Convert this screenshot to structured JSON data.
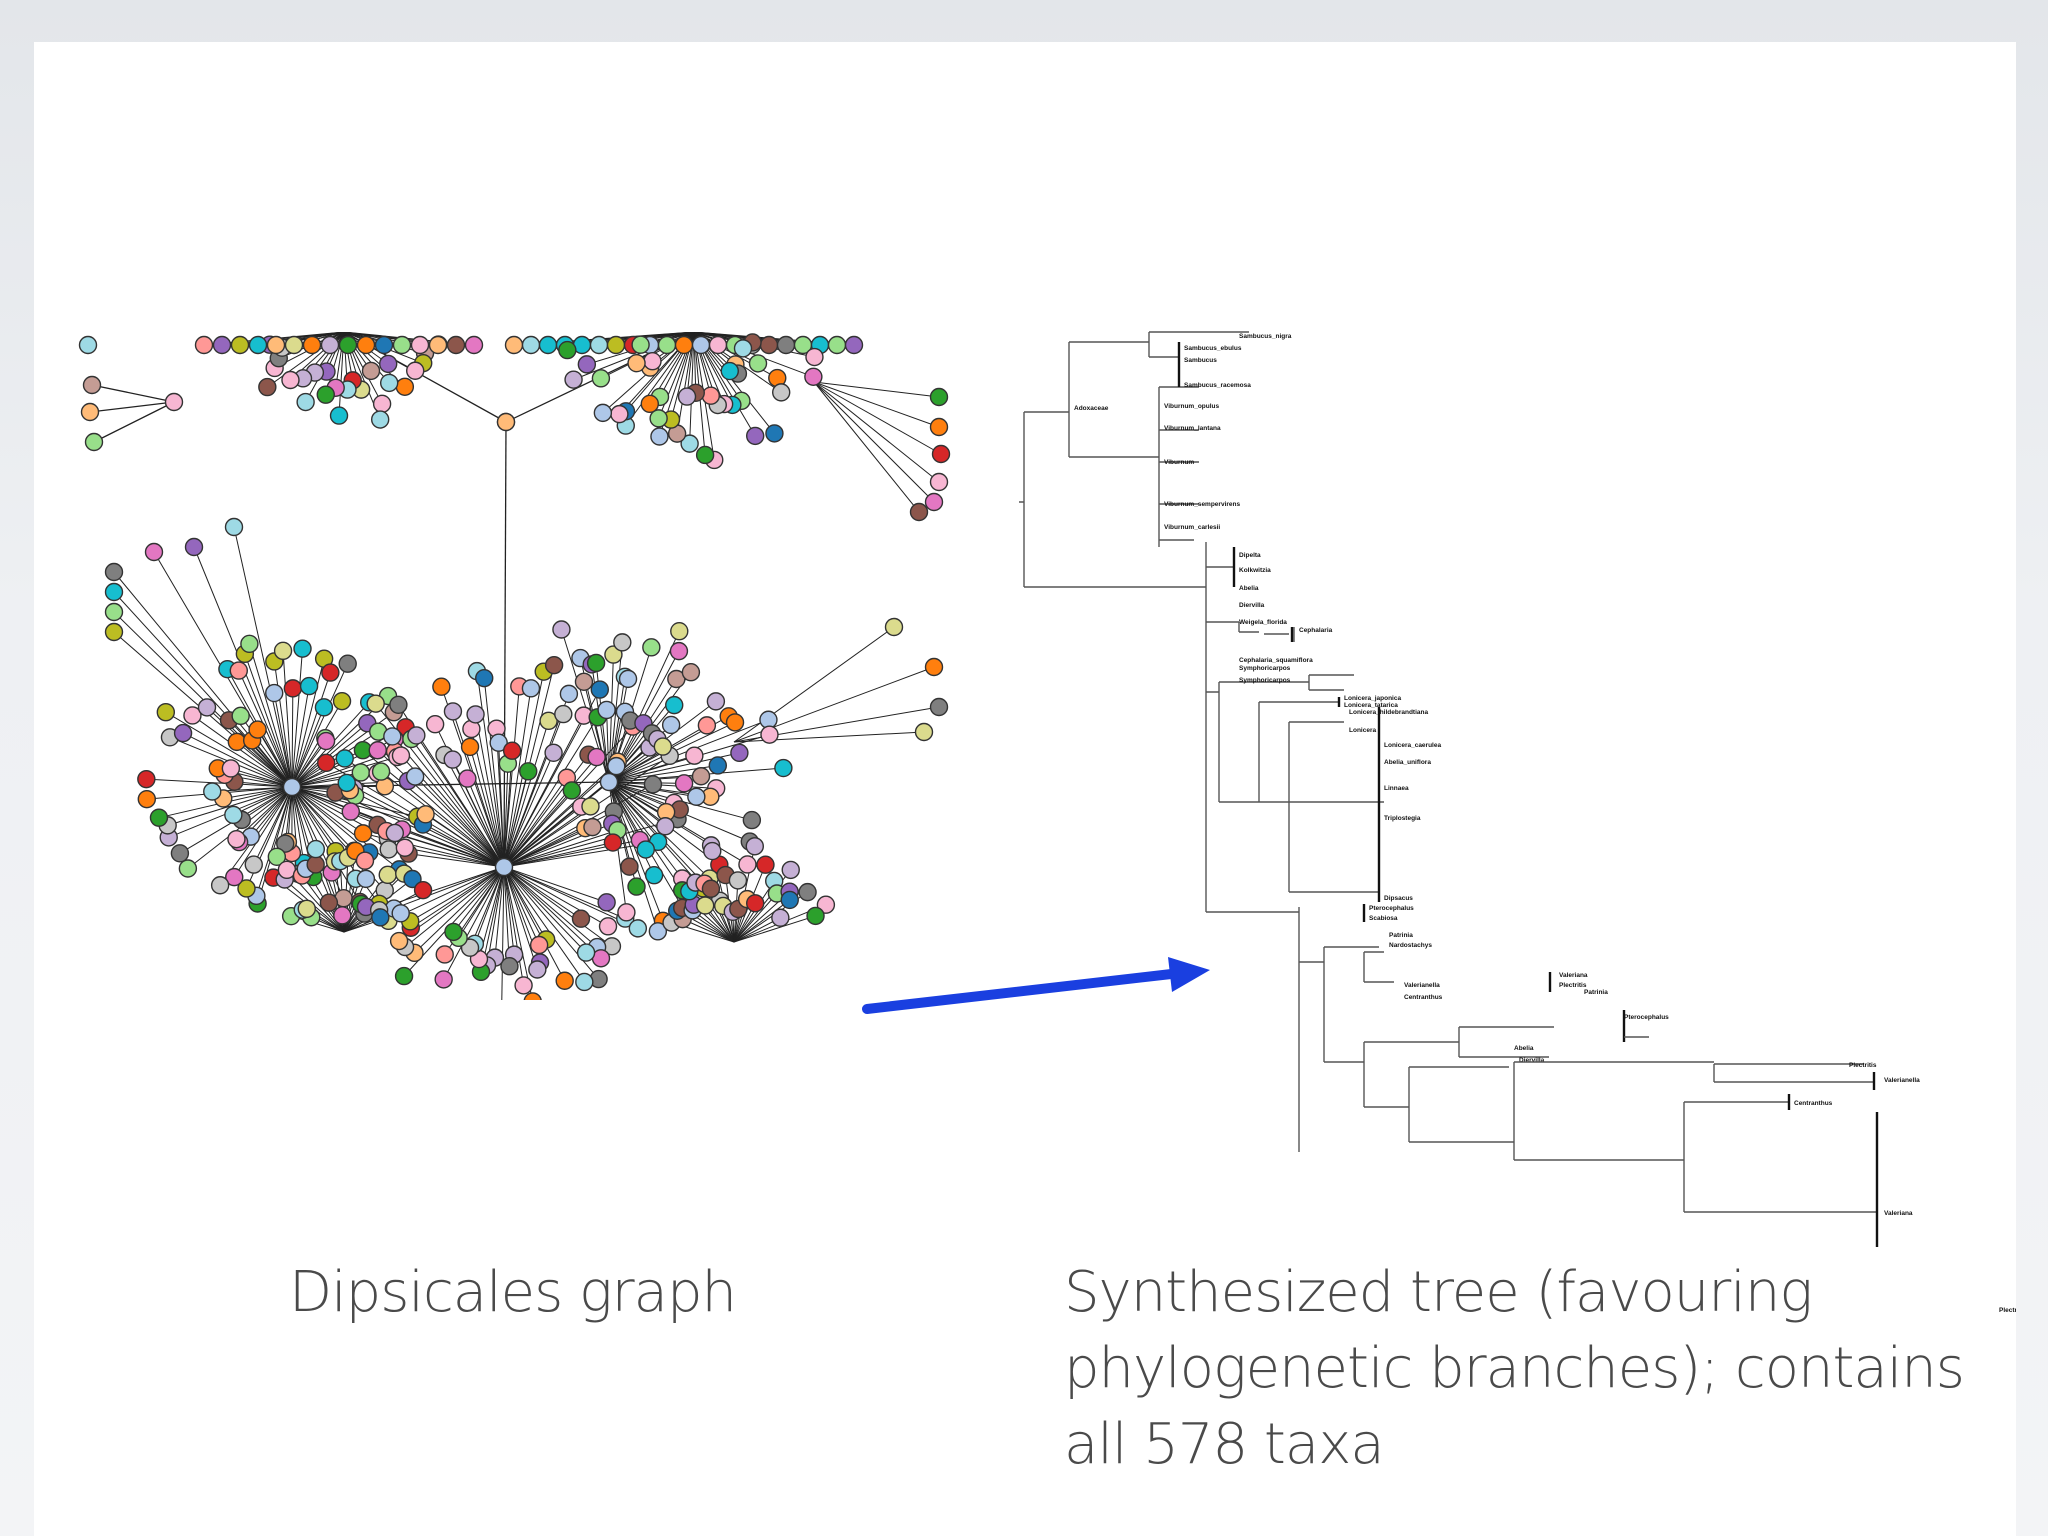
{
  "slide": {
    "left_caption": "Dipsicales graph",
    "right_caption_lines": [
      "Synthesized tree (favouring",
      "phylogenetic branches); contains",
      "all 578 taxa"
    ]
  },
  "arrow": {
    "color": "#1a3fe0"
  },
  "graph": {
    "node_colors": [
      "#aec7e8",
      "#ff7f0e",
      "#ffbb78",
      "#2ca02c",
      "#98df8a",
      "#d62728",
      "#ff9896",
      "#9467bd",
      "#c5b0d5",
      "#8c564b",
      "#c49c94",
      "#e377c2",
      "#f7b6d2",
      "#7f7f7f",
      "#c7c7c7",
      "#bcbd22",
      "#dbdb8d",
      "#17becf",
      "#9edae5",
      "#1f77b4"
    ]
  },
  "tree": {
    "labels": [
      "Sambucus_nigra",
      "Sambucus_ebulus",
      "Sambucus",
      "Sambucus_racemosa",
      "Adoxaceae",
      "Viburnum_opulus",
      "Viburnum_lantana",
      "Viburnum",
      "Viburnum_sempervirens",
      "Viburnum_carlesii",
      "Dipelta",
      "Kolkwitzia",
      "Abelia",
      "Diervilla",
      "Weigela_florida",
      "Cephalaria",
      "Cephalaria_squamiflora",
      "Symphoricarpos",
      "Lonicera_japonica",
      "Lonicera_tatarica",
      "Lonicera_hildebrandtiana",
      "Lonicera",
      "Lonicera_caerulea",
      "Abelia_uniflora",
      "Linnaea",
      "Triplostegia",
      "Dipsacus",
      "Pterocephalus",
      "Scabiosa",
      "Patrinia",
      "Nardostachys",
      "Valerianella",
      "Centranthus",
      "Valeriana",
      "Plectritis"
    ]
  }
}
